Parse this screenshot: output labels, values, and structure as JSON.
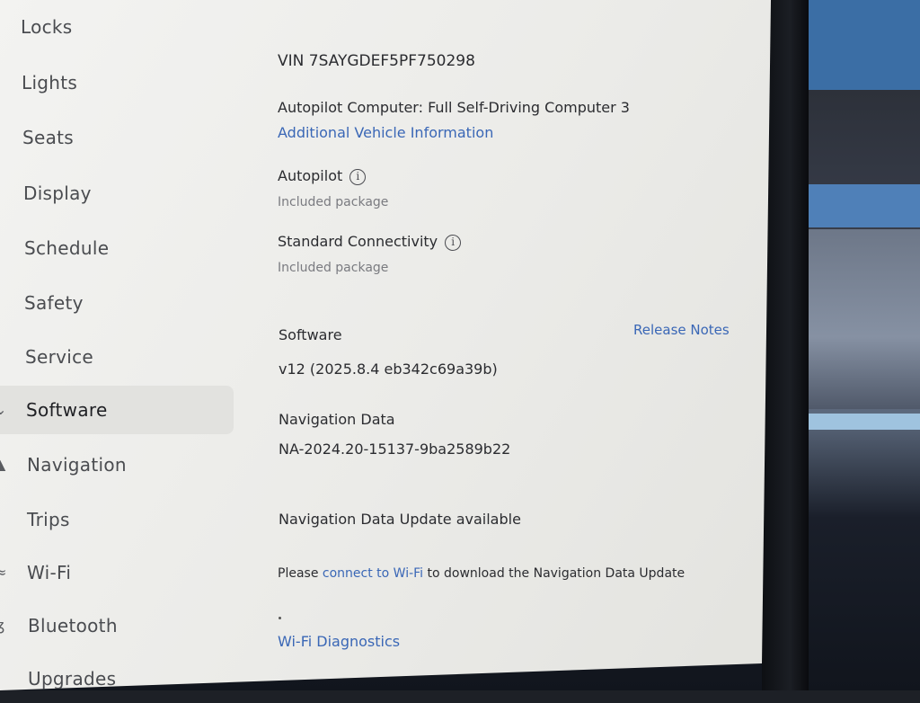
{
  "sidebar": {
    "items": [
      {
        "label": "Locks",
        "icon": "lock-icon"
      },
      {
        "label": "Lights",
        "icon": "light-icon"
      },
      {
        "label": "Seats",
        "icon": "seat-icon"
      },
      {
        "label": "Display",
        "icon": "display-icon"
      },
      {
        "label": "Schedule",
        "icon": "clock-icon"
      },
      {
        "label": "Safety",
        "icon": "safety-icon"
      },
      {
        "label": "Service",
        "icon": "wrench-icon"
      },
      {
        "label": "Software",
        "icon": "download-icon",
        "active": true
      },
      {
        "label": "Navigation",
        "icon": "navigation-icon"
      },
      {
        "label": "Trips",
        "icon": "trips-icon"
      },
      {
        "label": "Wi-Fi",
        "icon": "wifi-icon"
      },
      {
        "label": "Bluetooth",
        "icon": "bluetooth-icon"
      },
      {
        "label": "Upgrades",
        "icon": "upgrades-icon"
      }
    ]
  },
  "vehicle": {
    "vin": "VIN 7SAYGDEF5PF750298",
    "autopilot_computer": "Autopilot Computer: Full Self-Driving Computer 3",
    "additional_info_link": "Additional Vehicle Information"
  },
  "packages": [
    {
      "title": "Autopilot",
      "status": "Included package"
    },
    {
      "title": "Standard Connectivity",
      "status": "Included package"
    }
  ],
  "software": {
    "heading": "Software",
    "release_notes_link": "Release Notes",
    "version": "v12 (2025.8.4 eb342c69a39b)"
  },
  "navigation_data": {
    "heading": "Navigation Data",
    "version": "NA-2024.20-15137-9ba2589b22",
    "update_status": "Navigation Data Update available",
    "message_prefix": "Please ",
    "message_link": "connect to Wi-Fi",
    "message_suffix": " to download the Navigation Data Update",
    "wifi_diagnostics_link": "Wi-Fi Diagnostics"
  },
  "colors": {
    "accent": "#3a67b6",
    "screen_bg": "#efefec",
    "active_item_bg": "#e2e2df"
  }
}
